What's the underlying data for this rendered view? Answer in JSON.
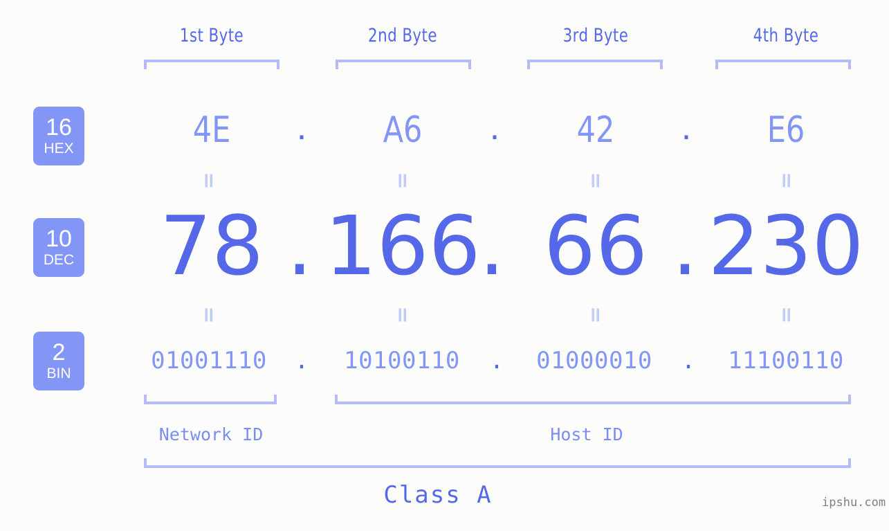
{
  "page": {
    "background_color": "#fcfdfa",
    "accent_strong": "#5568e8",
    "accent_light": "#8496f5",
    "bracket_color": "#b3bcf7",
    "badge_color": "#8496f5",
    "watermark": "ipshu.com"
  },
  "byte_headers": [
    {
      "label": "1st Byte"
    },
    {
      "label": "2nd Byte"
    },
    {
      "label": "3rd Byte"
    },
    {
      "label": "4th Byte"
    }
  ],
  "rows": [
    {
      "badge_number": "16",
      "badge_name": "HEX",
      "values": [
        "4E",
        "A6",
        "42",
        "E6"
      ],
      "separator": "."
    },
    {
      "badge_number": "10",
      "badge_name": "DEC",
      "values": [
        "78",
        "166",
        "66",
        "230"
      ],
      "separator": "."
    },
    {
      "badge_number": "2",
      "badge_name": "BIN",
      "values": [
        "01001110",
        "10100110",
        "01000010",
        "11100110"
      ],
      "separator": "."
    }
  ],
  "equals_marks": {
    "glyph": "=",
    "count_per_row": 4
  },
  "segments": {
    "network_id": "Network ID",
    "host_id": "Host ID",
    "class": "Class A"
  }
}
